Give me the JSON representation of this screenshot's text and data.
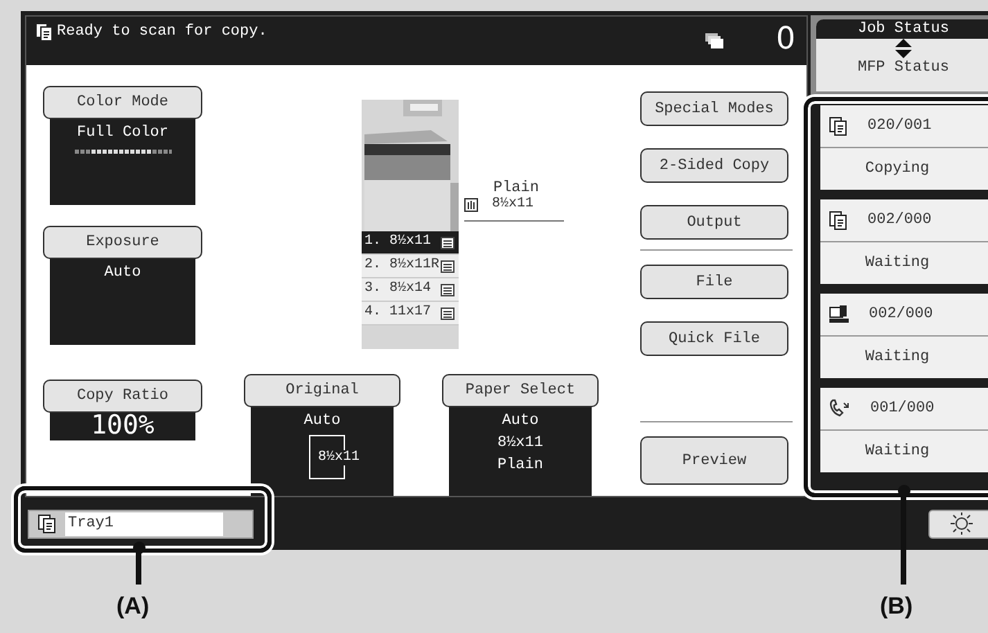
{
  "header": {
    "message": "Ready to scan for copy.",
    "copy_count": "0"
  },
  "left_settings": [
    {
      "kind": "scale",
      "label": "Color Mode",
      "lines": [
        "Full Color"
      ]
    },
    {
      "kind": "text",
      "label": "Exposure",
      "lines": [
        "Auto"
      ]
    },
    {
      "kind": "large",
      "label": "Copy Ratio",
      "lines": [
        "100%"
      ]
    }
  ],
  "bottom_settings": [
    {
      "kind": "paper",
      "label": "Original",
      "lines": [
        "Auto",
        "8½x11"
      ]
    },
    {
      "kind": "text",
      "label": "Paper Select",
      "lines": [
        "Auto",
        "8½x11",
        "Plain"
      ]
    }
  ],
  "trays": [
    {
      "label": "1. 8½x11",
      "selected": true
    },
    {
      "label": "2. 8½x11R",
      "selected": false
    },
    {
      "label": "3. 8½x14",
      "selected": false
    },
    {
      "label": "4. 11x17",
      "selected": false
    }
  ],
  "bypass_tray": {
    "type": "Plain",
    "size": "8½x11"
  },
  "button_groups": [
    [
      "Special Modes",
      "2-Sided Copy",
      "Output"
    ],
    [
      "File",
      "Quick File"
    ],
    [
      "Preview"
    ]
  ],
  "status_panel": {
    "title": "Job Status",
    "subtitle": "MFP Status"
  },
  "jobs": [
    {
      "kind": "copy",
      "count": "020/001",
      "status": "Copying"
    },
    {
      "kind": "copy",
      "count": "002/000",
      "status": "Waiting"
    },
    {
      "kind": "print",
      "count": "002/000",
      "status": "Waiting"
    },
    {
      "kind": "fax",
      "count": "001/000",
      "status": "Waiting"
    }
  ],
  "tray_field": {
    "value": "Tray1"
  },
  "callouts": [
    {
      "label": "(A)"
    },
    {
      "label": "(B)"
    }
  ]
}
